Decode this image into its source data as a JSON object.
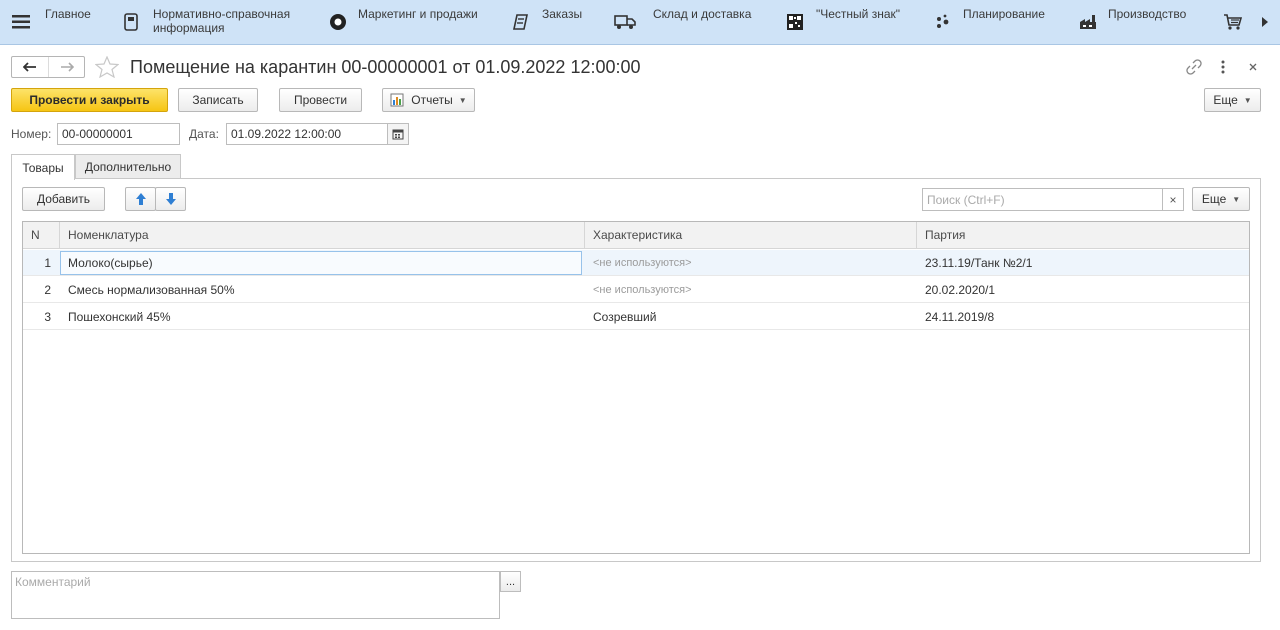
{
  "topnav": {
    "items": [
      {
        "icon": "menu-icon",
        "label": "Главное"
      },
      {
        "icon": "reference-info-icon",
        "label": "Нормативно-справочная информация"
      },
      {
        "icon": "marketing-icon",
        "label": "Маркетинг и продажи"
      },
      {
        "icon": "orders-icon",
        "label": "Заказы"
      },
      {
        "icon": "delivery-truck-icon",
        "label": "Склад и доставка"
      },
      {
        "icon": "qr-code-icon",
        "label": "\"Честный знак\""
      },
      {
        "icon": "planning-icon",
        "label": "Планирование"
      },
      {
        "icon": "factory-icon",
        "label": "Производство"
      },
      {
        "icon": "cart-icon",
        "label": ""
      }
    ],
    "label_line1": {
      "reference": "Нормативно-справочная",
      "reference_line2": "информация"
    }
  },
  "document": {
    "title": "Помещение на карантин 00-00000001 от 01.09.2022 12:00:00"
  },
  "toolbar": {
    "post_close": "Провести и закрыть",
    "save": "Записать",
    "post": "Провести",
    "reports": "Отчеты",
    "more": "Еще"
  },
  "fields": {
    "number_label": "Номер:",
    "number_value": "00-00000001",
    "date_label": "Дата:",
    "date_value": "01.09.2022 12:00:00"
  },
  "tabs": [
    {
      "label": "Товары",
      "active": true
    },
    {
      "label": "Дополнительно",
      "active": false
    }
  ],
  "table_toolbar": {
    "add": "Добавить",
    "search_placeholder": "Поиск (Ctrl+F)",
    "clear": "×",
    "more": "Еще"
  },
  "table": {
    "columns": [
      "N",
      "Номенклатура",
      "Характеристика",
      "Партия"
    ],
    "rows": [
      {
        "n": "1",
        "item": "Молоко(сырье)",
        "characteristic": "<не используются>",
        "characteristic_placeholder": true,
        "batch": "23.11.19/Танк №2/1",
        "selected": true
      },
      {
        "n": "2",
        "item": "Смесь нормализованная 50%",
        "characteristic": "<не используются>",
        "characteristic_placeholder": true,
        "batch": "20.02.2020/1",
        "selected": false
      },
      {
        "n": "3",
        "item": "Пошехонский 45%",
        "characteristic": "Созревший",
        "characteristic_placeholder": false,
        "batch": "24.11.2019/8",
        "selected": false
      }
    ]
  },
  "comment": {
    "placeholder": "Комментарий",
    "button": "..."
  },
  "colors": {
    "nav_bg": "#cfe3f7",
    "primary_button": "#f6c513",
    "selected_row": "#eef5fc",
    "arrow_blue": "#2f7fd3"
  }
}
